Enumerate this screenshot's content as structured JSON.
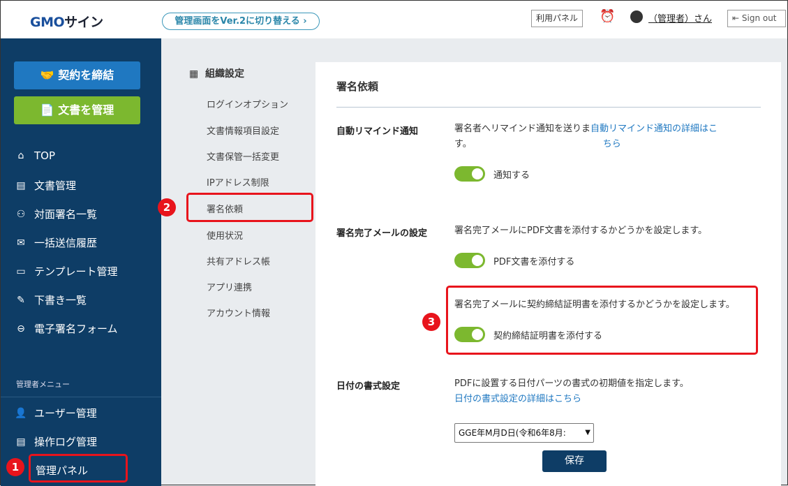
{
  "header": {
    "logo_a": "GMO",
    "logo_b": "サイン",
    "switch_label": "管理画面をVer.2に切り替える ›",
    "panel_label": "利用パネル",
    "alarm_icon": "⏰",
    "user": "（管理者）さん",
    "signout": "⇤ Sign out"
  },
  "sidebar": {
    "contract_btn": "🤝 契約を締結",
    "docs_btn": "📄 文書を管理",
    "items": [
      {
        "icon": "⌂",
        "label": "TOP"
      },
      {
        "icon": "▤",
        "label": "文書管理"
      },
      {
        "icon": "⚇",
        "label": "対面署名一覧"
      },
      {
        "icon": "✉",
        "label": "一括送信履歴"
      },
      {
        "icon": "▭",
        "label": "テンプレート管理"
      },
      {
        "icon": "✎",
        "label": "下書き一覧"
      },
      {
        "icon": "⊖",
        "label": "電子署名フォーム"
      }
    ],
    "admin_heading": "管理者メニュー",
    "admin_items": [
      {
        "icon": "👤",
        "label": "ユーザー管理"
      },
      {
        "icon": "▤",
        "label": "操作ログ管理"
      },
      {
        "icon": "",
        "label": "管理パネル"
      }
    ]
  },
  "submenu": {
    "heading": "組織設定",
    "items": [
      "ログインオプション",
      "文書情報項目設定",
      "文書保管一括変更",
      "IPアドレス制限",
      "署名依頼",
      "使用状況",
      "共有アドレス帳",
      "アプリ連携",
      "アカウント情報"
    ]
  },
  "main": {
    "title": "署名依頼",
    "remind": {
      "label": "自動リマインド通知",
      "text": "署名者へリマインド通知を送りま",
      "text2": "す。",
      "link": "自動リマインド通知の詳細はこ",
      "link2": "ちら",
      "toggle": "通知する",
      "on": true
    },
    "complete": {
      "label": "署名完了メールの設定",
      "text": "署名完了メールにPDF文書を添付するかどうかを設定します。",
      "toggle": "PDF文書を添付する",
      "on": true,
      "text2": "署名完了メールに契約締結証明書を添付するかどうかを設定します。",
      "toggle2": "契約締結証明書を添付する",
      "on2": true
    },
    "date": {
      "label": "日付の書式設定",
      "text": "PDFに設置する日付パーツの書式の初期値を指定します。",
      "link": "日付の書式設定の詳細はこちら",
      "selected": "GGE年M月D日(令和6年8月:"
    },
    "save": "保存"
  },
  "annotations": [
    "1",
    "2",
    "3"
  ],
  "colors": {
    "navy": "#0e3d66",
    "toggle": "#7cb82f",
    "red": "#e8141c",
    "blue_btn": "#1f78c1",
    "green_btn": "#7cb82f"
  }
}
